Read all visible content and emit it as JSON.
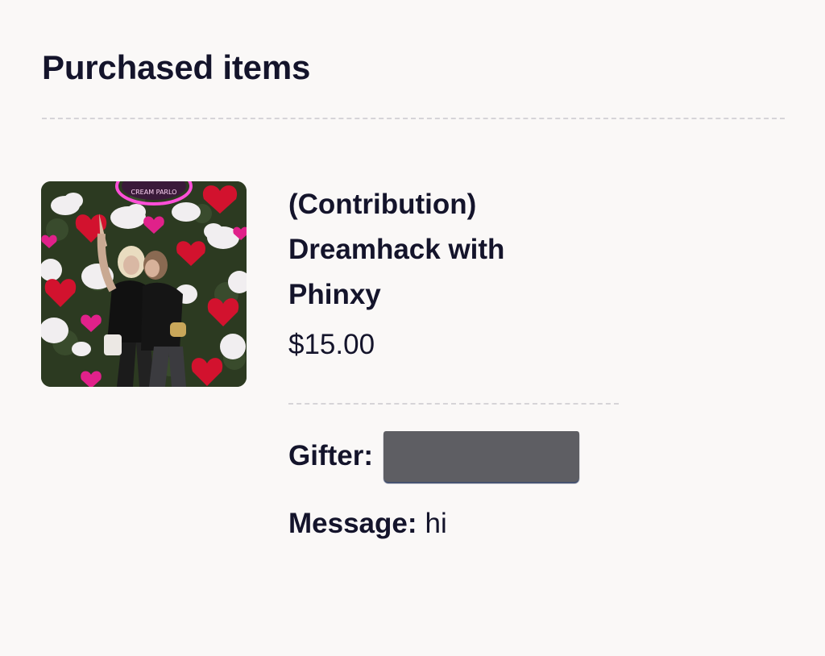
{
  "page": {
    "title": "Purchased items"
  },
  "item": {
    "name": "(Contribution) Dreamhack with Phinxy",
    "price": "$15.00",
    "image_sign_text": "CREAM PARLO",
    "gifter_label": "Gifter:",
    "gifter_value_redacted": true,
    "message_label": "Message:",
    "message_value": "hi"
  },
  "colors": {
    "background": "#faf8f7",
    "text": "#14142b",
    "divider": "#d6d4d8",
    "redaction": "#5e5e63"
  }
}
